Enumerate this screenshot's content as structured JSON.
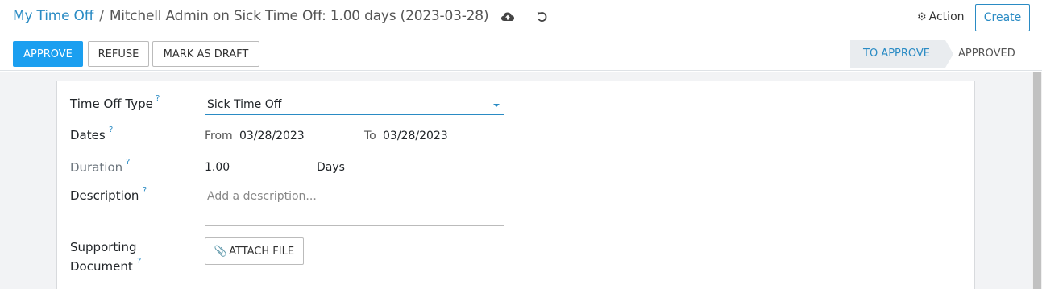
{
  "breadcrumb": {
    "parent": "My Time Off",
    "separator": "/",
    "current": "Mitchell Admin on Sick Time Off: 1.00 days (2023-03-28)"
  },
  "header": {
    "save_icon": "cloud-upload-icon",
    "discard_icon": "undo-icon",
    "action_label": "Action",
    "action_icon": "gear-icon",
    "create_label": "Create"
  },
  "buttons": {
    "approve": "APPROVE",
    "refuse": "REFUSE",
    "mark_as_draft": "MARK AS DRAFT"
  },
  "statusbar": {
    "current": "TO APPROVE",
    "next": "APPROVED"
  },
  "form": {
    "time_off_type": {
      "label": "Time Off Type",
      "help": "?",
      "value": "Sick Time Off"
    },
    "dates": {
      "label": "Dates",
      "help": "?",
      "from_label": "From",
      "from_value": "03/28/2023",
      "to_label": "To",
      "to_value": "03/28/2023"
    },
    "duration": {
      "label": "Duration",
      "help": "?",
      "value": "1.00",
      "unit": "Days"
    },
    "description": {
      "label": "Description",
      "help": "?",
      "placeholder": "Add a description..."
    },
    "supporting_document": {
      "label_line1": "Supporting",
      "label_line2": "Document",
      "help": "?",
      "button": "ATTACH FILE"
    }
  },
  "colors": {
    "accent": "#2a8bc4",
    "primary_button": "#1b9ff0",
    "background": "#f2f3f5"
  }
}
